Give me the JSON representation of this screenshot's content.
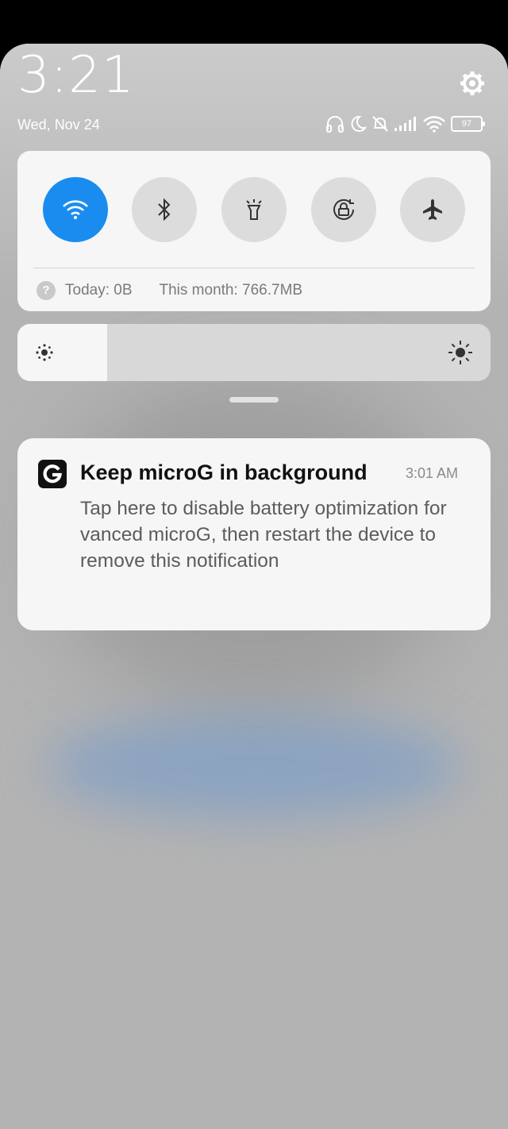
{
  "status": {
    "time": "3:21",
    "date": "Wed, Nov 24",
    "battery": "97",
    "icons": [
      "settings-gear",
      "headphones",
      "moon",
      "bell-off",
      "signal",
      "wifi",
      "battery"
    ]
  },
  "quick_settings": {
    "toggles": [
      {
        "name": "wifi",
        "active": true
      },
      {
        "name": "bluetooth",
        "active": false
      },
      {
        "name": "flashlight",
        "active": false
      },
      {
        "name": "auto-rotate-lock",
        "active": false
      },
      {
        "name": "airplane",
        "active": false
      }
    ],
    "data_usage": {
      "help_glyph": "?",
      "today": "Today: 0B",
      "this_month": "This month: 766.7MB"
    }
  },
  "brightness": {
    "level": 0.19
  },
  "notification": {
    "app_icon": "G",
    "title": "Keep microG in background",
    "time": "3:01 AM",
    "body": "Tap here to disable battery optimization for vanced microG, then restart the device to remove this notification"
  },
  "colors": {
    "accent": "#1a8cf0",
    "card": "#f6f6f6",
    "shade": "#b3b3b3"
  }
}
